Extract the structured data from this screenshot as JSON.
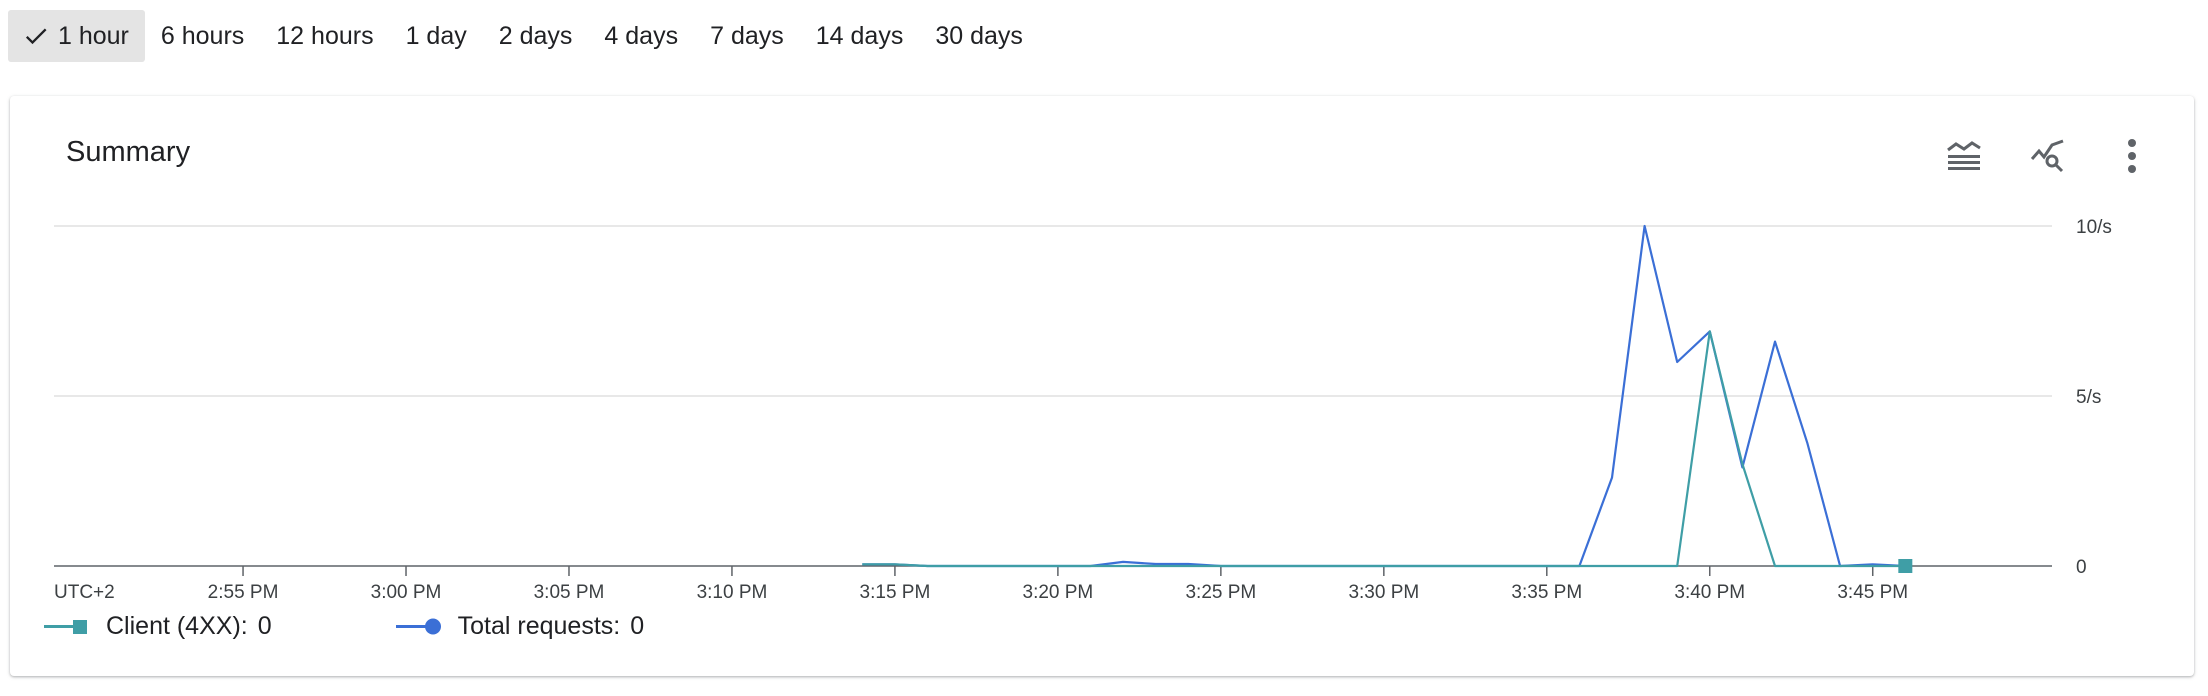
{
  "time_ranges": [
    {
      "label": "1 hour",
      "selected": true
    },
    {
      "label": "6 hours",
      "selected": false
    },
    {
      "label": "12 hours",
      "selected": false
    },
    {
      "label": "1 day",
      "selected": false
    },
    {
      "label": "2 days",
      "selected": false
    },
    {
      "label": "4 days",
      "selected": false
    },
    {
      "label": "7 days",
      "selected": false
    },
    {
      "label": "14 days",
      "selected": false
    },
    {
      "label": "30 days",
      "selected": false
    }
  ],
  "card": {
    "title": "Summary",
    "actions": [
      "legend-toggle-icon",
      "explore-metrics-icon",
      "more-vert-icon"
    ]
  },
  "colors": {
    "client": "#3f9ea6",
    "total": "#3b6fd6",
    "grid": "#e0e0e0",
    "axis": "#5f6368"
  },
  "chart_data": {
    "type": "line",
    "timezone_label": "UTC+2",
    "x_tick_labels": [
      "2:55 PM",
      "3:00 PM",
      "3:05 PM",
      "3:10 PM",
      "3:15 PM",
      "3:20 PM",
      "3:25 PM",
      "3:30 PM",
      "3:35 PM",
      "3:40 PM",
      "3:45 PM"
    ],
    "x_ticks_minutes": [
      55,
      60,
      65,
      70,
      75,
      80,
      85,
      90,
      95,
      100,
      105
    ],
    "x_unit_note": "minutes after 2:00 PM",
    "xlim": [
      49.2,
      110.5
    ],
    "y_tick_labels": [
      "10/s",
      "5/s",
      "0"
    ],
    "y_ticks": [
      10,
      5,
      0
    ],
    "ylim": [
      0,
      10
    ],
    "grid": true,
    "series": [
      {
        "name": "Client (4XX)",
        "legend_value": "0",
        "color": "#3f9ea6",
        "marker": "square",
        "points": [
          [
            74,
            0.05
          ],
          [
            75,
            0.05
          ],
          [
            76,
            0
          ],
          [
            98,
            0
          ],
          [
            99,
            0
          ],
          [
            100,
            6.9
          ],
          [
            101,
            3
          ],
          [
            102,
            0
          ],
          [
            104,
            0
          ],
          [
            105,
            0
          ],
          [
            106,
            0
          ]
        ]
      },
      {
        "name": "Total requests",
        "legend_value": "0",
        "color": "#3b6fd6",
        "marker": "circle",
        "points": [
          [
            74,
            0.05
          ],
          [
            75,
            0.05
          ],
          [
            76,
            0
          ],
          [
            80,
            0
          ],
          [
            81,
            0
          ],
          [
            82,
            0.12
          ],
          [
            83,
            0.06
          ],
          [
            84,
            0.06
          ],
          [
            85,
            0
          ],
          [
            96,
            0
          ],
          [
            97,
            2.6
          ],
          [
            98,
            10
          ],
          [
            99,
            6
          ],
          [
            100,
            6.9
          ],
          [
            101,
            2.9
          ],
          [
            102,
            6.6
          ],
          [
            103,
            3.6
          ],
          [
            104,
            0
          ],
          [
            105,
            0.05
          ],
          [
            106,
            0
          ]
        ]
      }
    ]
  },
  "legend": [
    {
      "label": "Client (4XX):",
      "value": "0"
    },
    {
      "label": "Total requests:",
      "value": "0"
    }
  ]
}
